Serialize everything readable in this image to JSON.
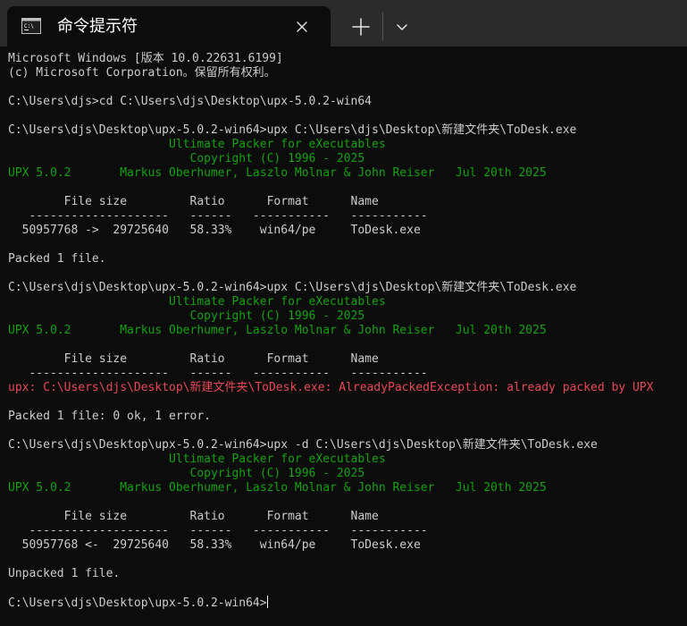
{
  "tab": {
    "title": "命令提示符",
    "icon": "cmd-icon"
  },
  "colors": {
    "background": "#0c0c0c",
    "titlebar": "#2b2b2b",
    "text": "#cccccc",
    "green": "#13a10e",
    "red": "#e74856"
  },
  "terminal": {
    "lines": [
      {
        "text": "Microsoft Windows [版本 10.0.22631.6199]",
        "color": "default"
      },
      {
        "text": "(c) Microsoft Corporation。保留所有权利。",
        "color": "default"
      },
      {
        "text": "",
        "color": "default"
      },
      {
        "text": "C:\\Users\\djs>cd C:\\Users\\djs\\Desktop\\upx-5.0.2-win64",
        "color": "default"
      },
      {
        "text": "",
        "color": "default"
      },
      {
        "text": "C:\\Users\\djs\\Desktop\\upx-5.0.2-win64>upx C:\\Users\\djs\\Desktop\\新建文件夹\\ToDesk.exe",
        "color": "default"
      },
      {
        "text": "                       Ultimate Packer for eXecutables",
        "color": "green"
      },
      {
        "text": "                          Copyright (C) 1996 - 2025",
        "color": "green"
      },
      {
        "text": "UPX 5.0.2       Markus Oberhumer, Laszlo Molnar & John Reiser   Jul 20th 2025",
        "color": "green"
      },
      {
        "text": "",
        "color": "default"
      },
      {
        "text": "        File size         Ratio      Format      Name",
        "color": "default"
      },
      {
        "text": "   --------------------   ------   -----------   -----------",
        "color": "default"
      },
      {
        "text": "  50957768 ->  29725640   58.33%    win64/pe     ToDesk.exe",
        "color": "default"
      },
      {
        "text": "",
        "color": "default"
      },
      {
        "text": "Packed 1 file.",
        "color": "default"
      },
      {
        "text": "",
        "color": "default"
      },
      {
        "text": "C:\\Users\\djs\\Desktop\\upx-5.0.2-win64>upx C:\\Users\\djs\\Desktop\\新建文件夹\\ToDesk.exe",
        "color": "default"
      },
      {
        "text": "                       Ultimate Packer for eXecutables",
        "color": "green"
      },
      {
        "text": "                          Copyright (C) 1996 - 2025",
        "color": "green"
      },
      {
        "text": "UPX 5.0.2       Markus Oberhumer, Laszlo Molnar & John Reiser   Jul 20th 2025",
        "color": "green"
      },
      {
        "text": "",
        "color": "default"
      },
      {
        "text": "        File size         Ratio      Format      Name",
        "color": "default"
      },
      {
        "text": "   --------------------   ------   -----------   -----------",
        "color": "default"
      },
      {
        "text": "upx: C:\\Users\\djs\\Desktop\\新建文件夹\\ToDesk.exe: AlreadyPackedException: already packed by UPX",
        "color": "red"
      },
      {
        "text": "",
        "color": "default"
      },
      {
        "text": "Packed 1 file: 0 ok, 1 error.",
        "color": "default"
      },
      {
        "text": "",
        "color": "default"
      },
      {
        "text": "C:\\Users\\djs\\Desktop\\upx-5.0.2-win64>upx -d C:\\Users\\djs\\Desktop\\新建文件夹\\ToDesk.exe",
        "color": "default"
      },
      {
        "text": "                       Ultimate Packer for eXecutables",
        "color": "green"
      },
      {
        "text": "                          Copyright (C) 1996 - 2025",
        "color": "green"
      },
      {
        "text": "UPX 5.0.2       Markus Oberhumer, Laszlo Molnar & John Reiser   Jul 20th 2025",
        "color": "green"
      },
      {
        "text": "",
        "color": "default"
      },
      {
        "text": "        File size         Ratio      Format      Name",
        "color": "default"
      },
      {
        "text": "   --------------------   ------   -----------   -----------",
        "color": "default"
      },
      {
        "text": "  50957768 <-  29725640   58.33%    win64/pe     ToDesk.exe",
        "color": "default"
      },
      {
        "text": "",
        "color": "default"
      },
      {
        "text": "Unpacked 1 file.",
        "color": "default"
      },
      {
        "text": "",
        "color": "default"
      }
    ],
    "prompt": "C:\\Users\\djs\\Desktop\\upx-5.0.2-win64>"
  }
}
